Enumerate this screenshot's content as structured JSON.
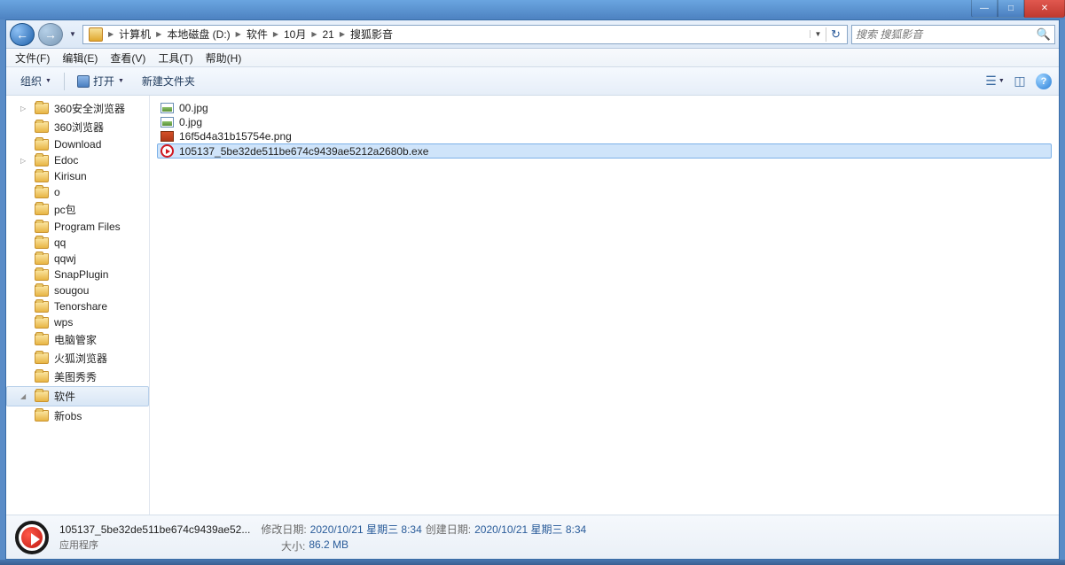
{
  "window_controls": {
    "min": "—",
    "max": "□",
    "close": "✕"
  },
  "breadcrumb": [
    "计算机",
    "本地磁盘 (D:)",
    "软件",
    "10月",
    "21",
    "搜狐影音"
  ],
  "search_placeholder": "搜索 搜狐影音",
  "menus": {
    "file": "文件(F)",
    "edit": "编辑(E)",
    "view": "查看(V)",
    "tools": "工具(T)",
    "help": "帮助(H)"
  },
  "toolbar": {
    "organize": "组织",
    "open": "打开",
    "newfolder": "新建文件夹"
  },
  "sidebar": [
    {
      "label": "360安全浏览器",
      "exp": "▷"
    },
    {
      "label": "360浏览器"
    },
    {
      "label": "Download"
    },
    {
      "label": "Edoc",
      "exp": "▷"
    },
    {
      "label": "Kirisun"
    },
    {
      "label": "o"
    },
    {
      "label": "pc包"
    },
    {
      "label": "Program Files"
    },
    {
      "label": "qq"
    },
    {
      "label": "qqwj"
    },
    {
      "label": "SnapPlugin"
    },
    {
      "label": "sougou"
    },
    {
      "label": "Tenorshare"
    },
    {
      "label": "wps"
    },
    {
      "label": "电脑管家"
    },
    {
      "label": "火狐浏览器"
    },
    {
      "label": "美图秀秀"
    },
    {
      "label": "软件",
      "selected": true,
      "exp": "◢"
    },
    {
      "label": "新obs"
    }
  ],
  "files": [
    {
      "name": "00.jpg",
      "icon": "img"
    },
    {
      "name": "0.jpg",
      "icon": "img"
    },
    {
      "name": "16f5d4a31b15754e.png",
      "icon": "png"
    },
    {
      "name": "105137_5be32de511be674c9439ae5212a2680b.exe",
      "icon": "exe",
      "selected": true
    }
  ],
  "details": {
    "name": "105137_5be32de511be674c9439ae52...",
    "type": "应用程序",
    "mod_label": "修改日期:",
    "mod_val": "2020/10/21 星期三 8:34",
    "created_label": "创建日期:",
    "created_val": "2020/10/21 星期三 8:34",
    "size_label": "大小:",
    "size_val": "86.2 MB"
  }
}
